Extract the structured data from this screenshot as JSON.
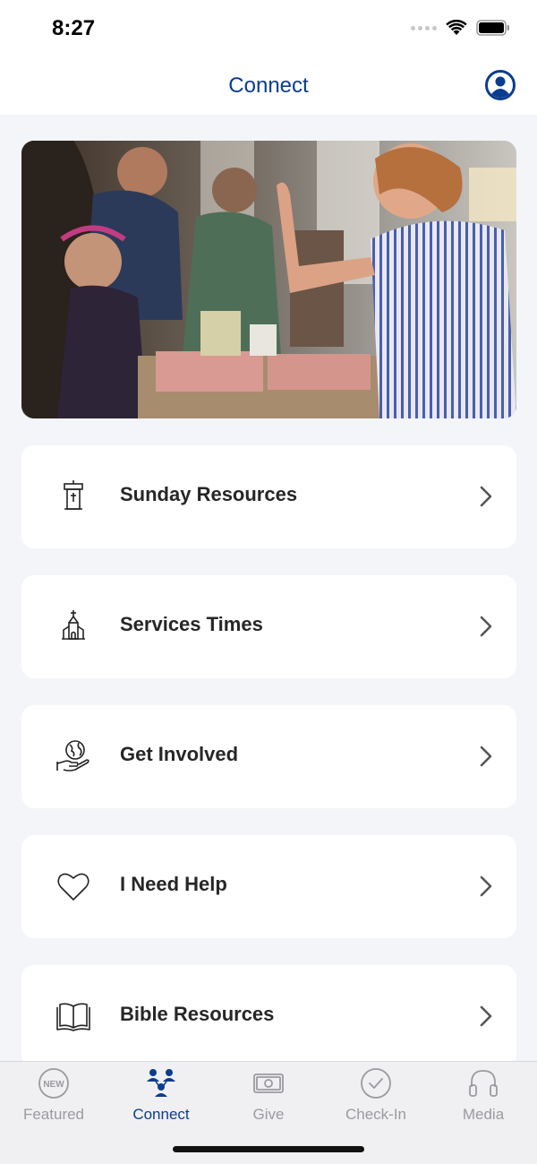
{
  "status": {
    "time": "8:27"
  },
  "header": {
    "title": "Connect"
  },
  "cards": [
    {
      "label": "Sunday Resources",
      "icon": "pulpit-icon"
    },
    {
      "label": "Services Times",
      "icon": "church-icon"
    },
    {
      "label": "Get Involved",
      "icon": "globe-hand-icon"
    },
    {
      "label": "I Need Help",
      "icon": "heart-icon"
    },
    {
      "label": "Bible Resources",
      "icon": "book-icon"
    }
  ],
  "tabs": [
    {
      "label": "Featured",
      "icon": "new-badge-icon",
      "badge": "NEW"
    },
    {
      "label": "Connect",
      "icon": "people-icon"
    },
    {
      "label": "Give",
      "icon": "money-icon"
    },
    {
      "label": "Check-In",
      "icon": "check-circle-icon"
    },
    {
      "label": "Media",
      "icon": "headphones-icon"
    }
  ],
  "colors": {
    "accent": "#0a3d8f",
    "inactive": "#9a9aa0",
    "background": "#f4f5f9"
  }
}
